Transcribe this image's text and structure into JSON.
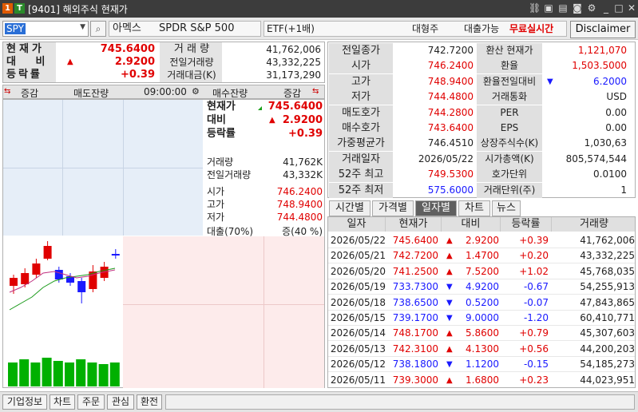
{
  "window": {
    "badge1": "1",
    "badge2": "T",
    "title": "[9401] 해외주식 현재가",
    "controls": [
      "link-icon",
      "copy-icon",
      "save-icon",
      "camera-icon",
      "settings-icon",
      "minimize-icon",
      "maximize-icon",
      "close-icon"
    ]
  },
  "toolbar": {
    "code": "SPY",
    "exchange": "아멕스",
    "name": "SPDR S&P 500",
    "etf_type": "ETF(+1배)",
    "size": "대형주",
    "loan": "대출가능",
    "realtime": "무료실시간",
    "disclaimer": "Disclaimer"
  },
  "summary": {
    "price_label": "현재가",
    "price": "745.6400",
    "change_label": "대 비",
    "change": "2.9200",
    "rate_label": "등락률",
    "rate": "+0.39",
    "volume_label": "거 래 량",
    "volume": "41,762,006",
    "prev_volume_label": "전일거래량",
    "prev_volume": "43,332,225",
    "amount_label": "거래대금(K)",
    "amount": "31,173,290"
  },
  "orderbook": {
    "headers": [
      "증감",
      "매도잔량",
      "09:00:00",
      "매수잔량",
      "증감"
    ],
    "price_label": "현재가",
    "price": "745.6400",
    "change_label": "대비",
    "change": "2.9200",
    "rate_label": "등락률",
    "rate": "+0.39",
    "volume_label": "거래량",
    "volume": "41,762K",
    "prev_volume_label": "전일거래량",
    "prev_volume": "43,332K",
    "open_label": "시가",
    "open": "746.2400",
    "high_label": "고가",
    "high": "748.9400",
    "low_label": "저가",
    "low": "744.4800",
    "ratio_label": "대출(70%)",
    "ratio_value": "증(40 %)"
  },
  "info": {
    "rows": [
      {
        "l1": "전일종가",
        "v1": "742.7200",
        "l2": "환산 현재가",
        "v2": "1,121,070",
        "c1": "black",
        "c2": "red"
      },
      {
        "l1": "시가",
        "v1": "746.2400",
        "l2": "환율",
        "v2": "1,503.5000",
        "c1": "red",
        "c2": "red"
      },
      {
        "l1": "고가",
        "v1": "748.9400",
        "l2": "환율전일대비",
        "v2": "6.2000",
        "c1": "red",
        "c2": "blue"
      },
      {
        "l1": "저가",
        "v1": "744.4800",
        "l2": "거래통화",
        "v2": "USD",
        "c1": "red",
        "c2": "black"
      },
      {
        "l1": "매도호가",
        "v1": "744.2800",
        "l2": "PER",
        "v2": "0.00",
        "c1": "red",
        "c2": "black"
      },
      {
        "l1": "매수호가",
        "v1": "743.6400",
        "l2": "EPS",
        "v2": "0.00",
        "c1": "red",
        "c2": "black"
      },
      {
        "l1": "가중평균가",
        "v1": "746.4510",
        "l2": "상장주식수(K)",
        "v2": "1,030,63",
        "c1": "black",
        "c2": "black"
      },
      {
        "l1": "거래일자",
        "v1": "2026/05/22",
        "l2": "시가총액(K)",
        "v2": "805,574,544",
        "c1": "black",
        "c2": "black"
      },
      {
        "l1": "52주 최고",
        "v1": "749.5300",
        "l2": "호가단위",
        "v2": "0.0100",
        "c1": "red",
        "c2": "black"
      },
      {
        "l1": "52주 최저",
        "v1": "575.6000",
        "l2": "거래단위(주)",
        "v2": "1",
        "c1": "blue",
        "c2": "black"
      }
    ]
  },
  "tabs": [
    "시간별",
    "가격별",
    "일자별",
    "차트",
    "뉴스"
  ],
  "daily": {
    "headers": [
      "일자",
      "현재가",
      "대비",
      "등락률",
      "거래량"
    ],
    "rows": [
      {
        "date": "2026/05/22",
        "price": "745.6400",
        "dir": "up",
        "change": "2.9200",
        "rate": "+0.39",
        "volume": "41,762,006"
      },
      {
        "date": "2026/05/21",
        "price": "742.7200",
        "dir": "up",
        "change": "1.4700",
        "rate": "+0.20",
        "volume": "43,332,225"
      },
      {
        "date": "2026/05/20",
        "price": "741.2500",
        "dir": "up",
        "change": "7.5200",
        "rate": "+1.02",
        "volume": "45,768,035"
      },
      {
        "date": "2026/05/19",
        "price": "733.7300",
        "dir": "down",
        "change": "4.9200",
        "rate": "-0.67",
        "volume": "54,255,913"
      },
      {
        "date": "2026/05/18",
        "price": "738.6500",
        "dir": "down",
        "change": "0.5200",
        "rate": "-0.07",
        "volume": "47,843,865"
      },
      {
        "date": "2026/05/15",
        "price": "739.1700",
        "dir": "down",
        "change": "9.0000",
        "rate": "-1.20",
        "volume": "60,410,771"
      },
      {
        "date": "2026/05/14",
        "price": "748.1700",
        "dir": "up",
        "change": "5.8600",
        "rate": "+0.79",
        "volume": "45,307,603"
      },
      {
        "date": "2026/05/13",
        "price": "742.3100",
        "dir": "up",
        "change": "4.1300",
        "rate": "+0.56",
        "volume": "44,200,203"
      },
      {
        "date": "2026/05/12",
        "price": "738.1800",
        "dir": "down",
        "change": "1.1200",
        "rate": "-0.15",
        "volume": "54,185,273"
      },
      {
        "date": "2026/05/11",
        "price": "739.3000",
        "dir": "up",
        "change": "1.6800",
        "rate": "+0.23",
        "volume": "44,023,951"
      }
    ]
  },
  "bottom": [
    "기업정보",
    "차트",
    "주문",
    "관심",
    "환전"
  ],
  "colors": {
    "up": "#e00000",
    "down": "#1a1aff",
    "candle_up": "#e00000",
    "candle_down": "#1a1aff",
    "volume": "#00b000",
    "accent": "#2a6fd6"
  }
}
